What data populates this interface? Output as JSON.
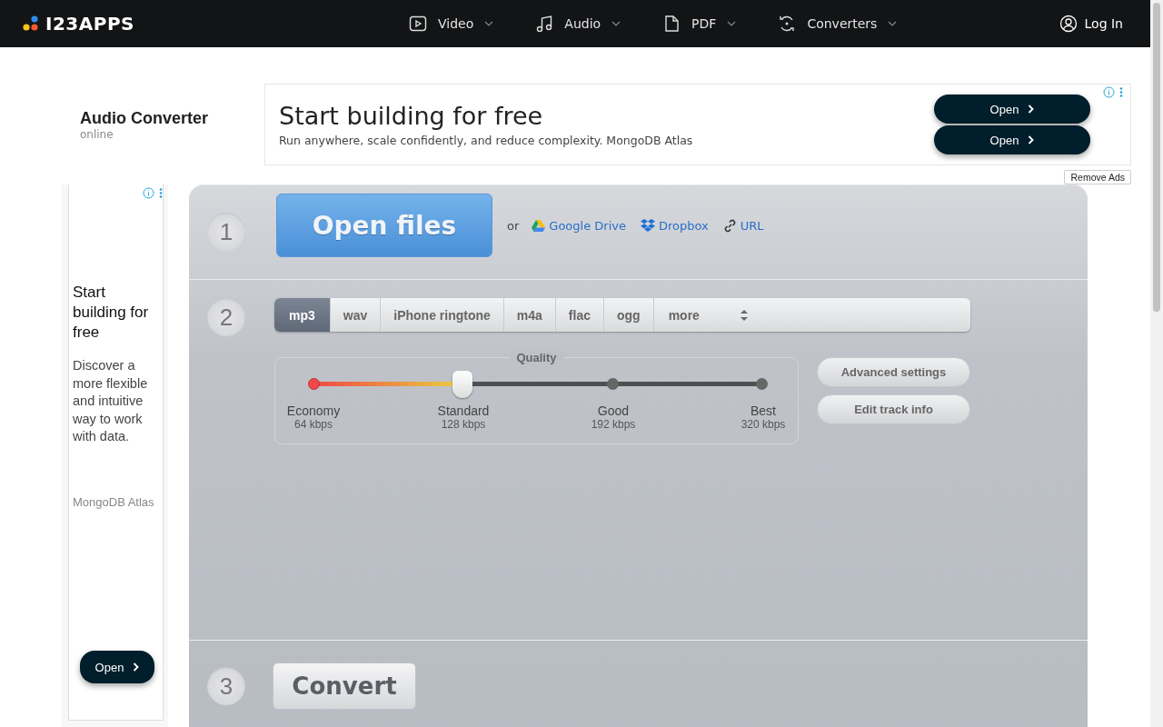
{
  "header": {
    "logo": "I23APPS",
    "nav": [
      {
        "kind": "video",
        "label": "Video"
      },
      {
        "kind": "audio",
        "label": "Audio"
      },
      {
        "kind": "pdf",
        "label": "PDF"
      },
      {
        "kind": "converters",
        "label": "Converters"
      }
    ],
    "login": "Log In"
  },
  "app_title": {
    "title": "Audio Converter",
    "subtitle": "online"
  },
  "top_ad": {
    "headline": "Start building for free",
    "text": "Run anywhere, scale confidently, and reduce complexity. MongoDB Atlas",
    "buttons": [
      "Open",
      "Open"
    ]
  },
  "remove_ads": "Remove Ads",
  "side_ad": {
    "headline": "Start building for free",
    "text": "Discover a more flexible and intuitive way to work with data.",
    "brand": "MongoDB Atlas",
    "button": "Open"
  },
  "step1": {
    "number": "1",
    "button": "Open files",
    "or": "or",
    "links": [
      {
        "kind": "gdrive",
        "label": "Google Drive"
      },
      {
        "kind": "dropbox",
        "label": "Dropbox"
      },
      {
        "kind": "url",
        "label": "URL"
      }
    ]
  },
  "step2": {
    "number": "2",
    "formats": [
      {
        "label": "mp3",
        "selected": true
      },
      {
        "label": "wav",
        "selected": false
      },
      {
        "label": "iPhone ringtone",
        "selected": false
      },
      {
        "label": "m4a",
        "selected": false
      },
      {
        "label": "flac",
        "selected": false
      },
      {
        "label": "ogg",
        "selected": false
      }
    ],
    "more": "more",
    "quality": {
      "title": "Quality",
      "level": 0.333,
      "stops": [
        {
          "name": "Economy",
          "rate": "64 kbps"
        },
        {
          "name": "Standard",
          "rate": "128 kbps"
        },
        {
          "name": "Good",
          "rate": "192 kbps"
        },
        {
          "name": "Best",
          "rate": "320 kbps"
        }
      ]
    },
    "buttons": [
      "Advanced settings",
      "Edit track info"
    ]
  },
  "step3": {
    "number": "3",
    "button": "Convert"
  }
}
